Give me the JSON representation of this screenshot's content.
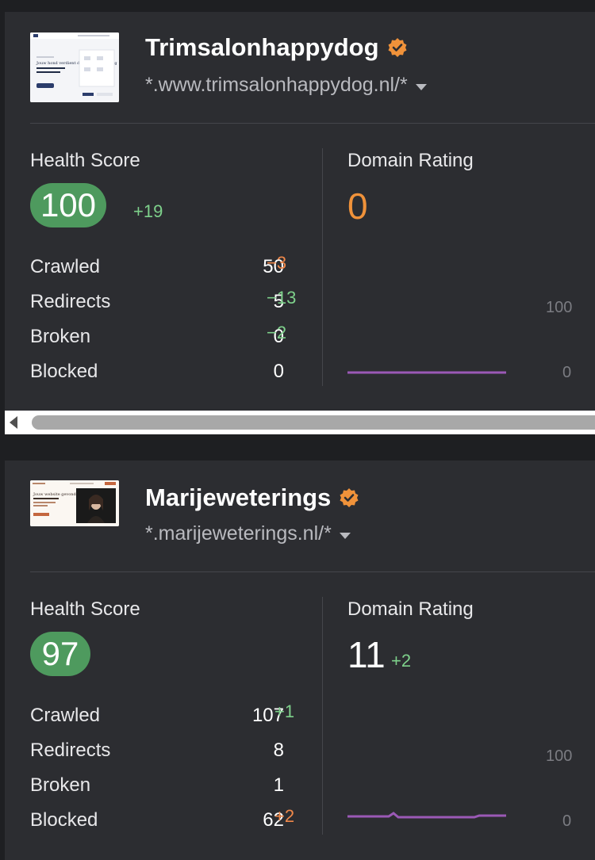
{
  "colors": {
    "page_bg": "#1e1f22",
    "card_bg": "#2c2d31",
    "health_pill": "#4e9a5e",
    "positive_delta": "#7ed18b",
    "negative_delta": "#f0884a",
    "dr_zero": "#f0923a",
    "chart_line": "#9b59b6",
    "verified_badge": "#f0923a"
  },
  "projects": [
    {
      "name": "Trimsalonhappydog",
      "verified_icon": "verified-badge-icon",
      "url": "*.www.trimsalonhappydog.nl/*",
      "health_score_label": "Health Score",
      "health_score": "100",
      "health_score_delta": "+19",
      "domain_rating_label": "Domain Rating",
      "domain_rating": "0",
      "domain_rating_delta": "",
      "stats": [
        {
          "name": "Crawled",
          "value": "50",
          "delta": "−3"
        },
        {
          "name": "Redirects",
          "value": "5",
          "delta": "−13"
        },
        {
          "name": "Broken",
          "value": "0",
          "delta": "−2"
        },
        {
          "name": "Blocked",
          "value": "0",
          "delta": ""
        }
      ],
      "chart_axis_max": "100",
      "chart_axis_min": "0",
      "thumbnail": {
        "headline": "Jouw hond verdient de beste verzorging"
      }
    },
    {
      "name": "Marijeweterings",
      "verified_icon": "verified-badge-icon",
      "url": "*.marijeweterings.nl/*",
      "health_score_label": "Health Score",
      "health_score": "97",
      "health_score_delta": "",
      "domain_rating_label": "Domain Rating",
      "domain_rating": "11",
      "domain_rating_delta": "+2",
      "stats": [
        {
          "name": "Crawled",
          "value": "107",
          "delta": "+1"
        },
        {
          "name": "Redirects",
          "value": "8",
          "delta": ""
        },
        {
          "name": "Broken",
          "value": "1",
          "delta": ""
        },
        {
          "name": "Blocked",
          "value": "62",
          "delta": "+2"
        }
      ],
      "chart_axis_max": "100",
      "chart_axis_min": "0",
      "thumbnail": {
        "headline": "Jouw website gevonden"
      }
    }
  ]
}
